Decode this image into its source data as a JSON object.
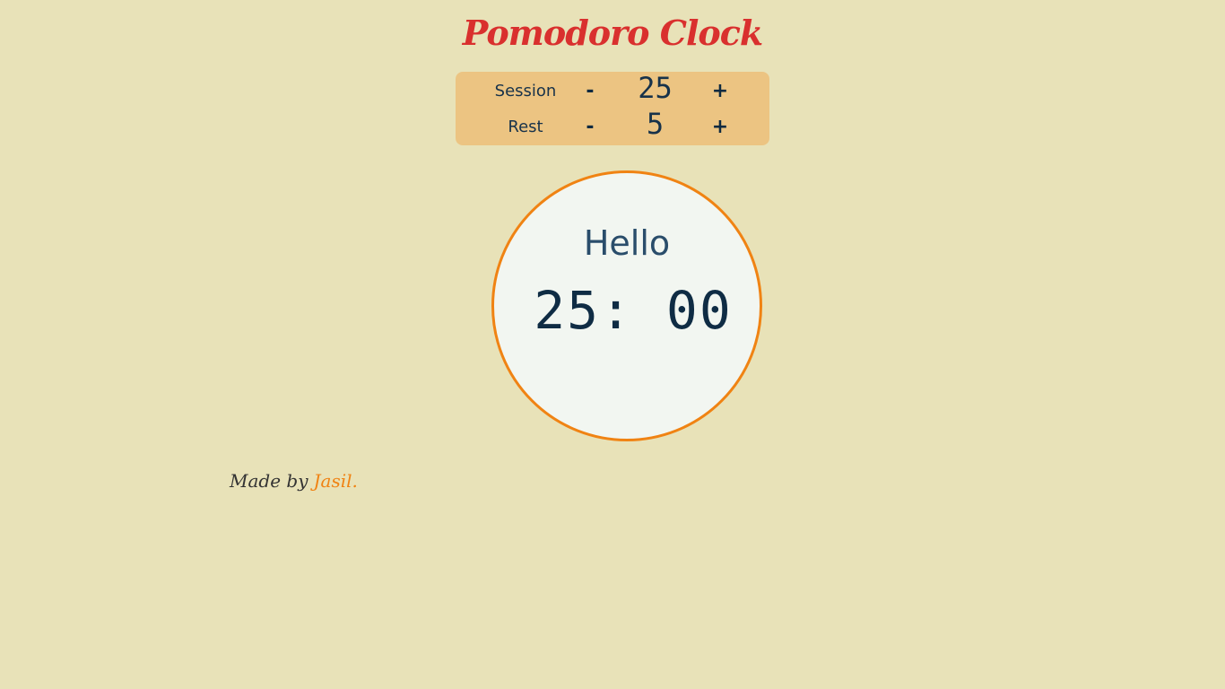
{
  "header": {
    "title": "Pomodoro Clock"
  },
  "controls": {
    "session": {
      "label": "Session",
      "decrement": "-",
      "value": "25",
      "increment": "+"
    },
    "rest": {
      "label": "Rest",
      "decrement": "-",
      "value": "5",
      "increment": "+"
    }
  },
  "clock": {
    "status": "Hello",
    "time": "25: 00"
  },
  "footer": {
    "made_by": "Made by",
    "author": "Jasil."
  },
  "colors": {
    "background": "#e8e2b8",
    "title": "#d9302e",
    "panel": "#ecc482",
    "clock_border": "#f08313",
    "clock_face": "#f2f6f1",
    "text_dark": "#0f2c44",
    "author": "#f08313"
  }
}
